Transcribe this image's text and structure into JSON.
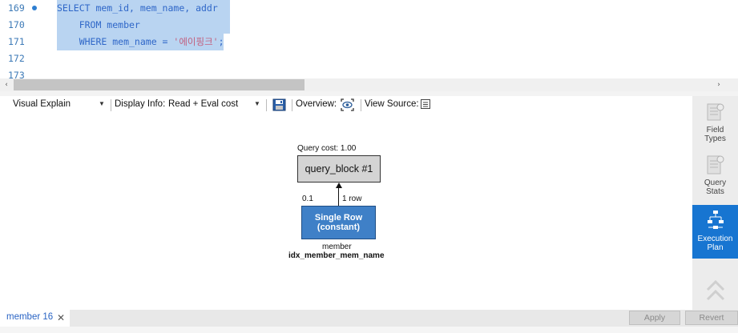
{
  "editor": {
    "lines": [
      {
        "no": "169",
        "text": "SELECT mem_id, mem_name, addr",
        "has_dot": true
      },
      {
        "no": "170",
        "text": "    FROM member",
        "has_dot": false
      },
      {
        "no": "171",
        "text_pre": "    WHERE mem_name = ",
        "text_str": "'에이핑크'",
        "text_post": ";",
        "has_dot": false
      },
      {
        "no": "172",
        "text": "",
        "has_dot": false
      },
      {
        "no": "173",
        "text": "",
        "has_dot": false
      }
    ]
  },
  "scrollbar": {
    "left_arrow": "‹",
    "right_arrow": "›"
  },
  "toolbar": {
    "view_mode": "Visual Explain",
    "display_info_label": "Display Info:",
    "display_info_value": "Read + Eval cost",
    "overview_label": "Overview:",
    "view_source_label": "View Source:",
    "save_icon": "save-icon",
    "overview_icon": "eye-icon",
    "source_icon": "document-icon"
  },
  "plan": {
    "query_cost_label": "Query cost: 1.00",
    "query_block": "query_block #1",
    "cost_left": "0.1",
    "rows_label": "1 row",
    "node_line1": "Single Row",
    "node_line2": "(constant)",
    "table_name": "member",
    "index_name": "idx_member_mem_name",
    "colors": {
      "node_fill": "#3f80c7",
      "block_fill": "#d4d4d4"
    }
  },
  "sidepanel": {
    "tabs": [
      {
        "label1": "Field",
        "label2": "Types",
        "active": false
      },
      {
        "label1": "Query",
        "label2": "Stats",
        "active": false
      },
      {
        "label1": "Execution",
        "label2": "Plan",
        "active": true
      }
    ],
    "accent": "#1775d1"
  },
  "bottom": {
    "tab_label": "member 16",
    "close_glyph": "✕",
    "apply_label": "Apply",
    "revert_label": "Revert"
  }
}
